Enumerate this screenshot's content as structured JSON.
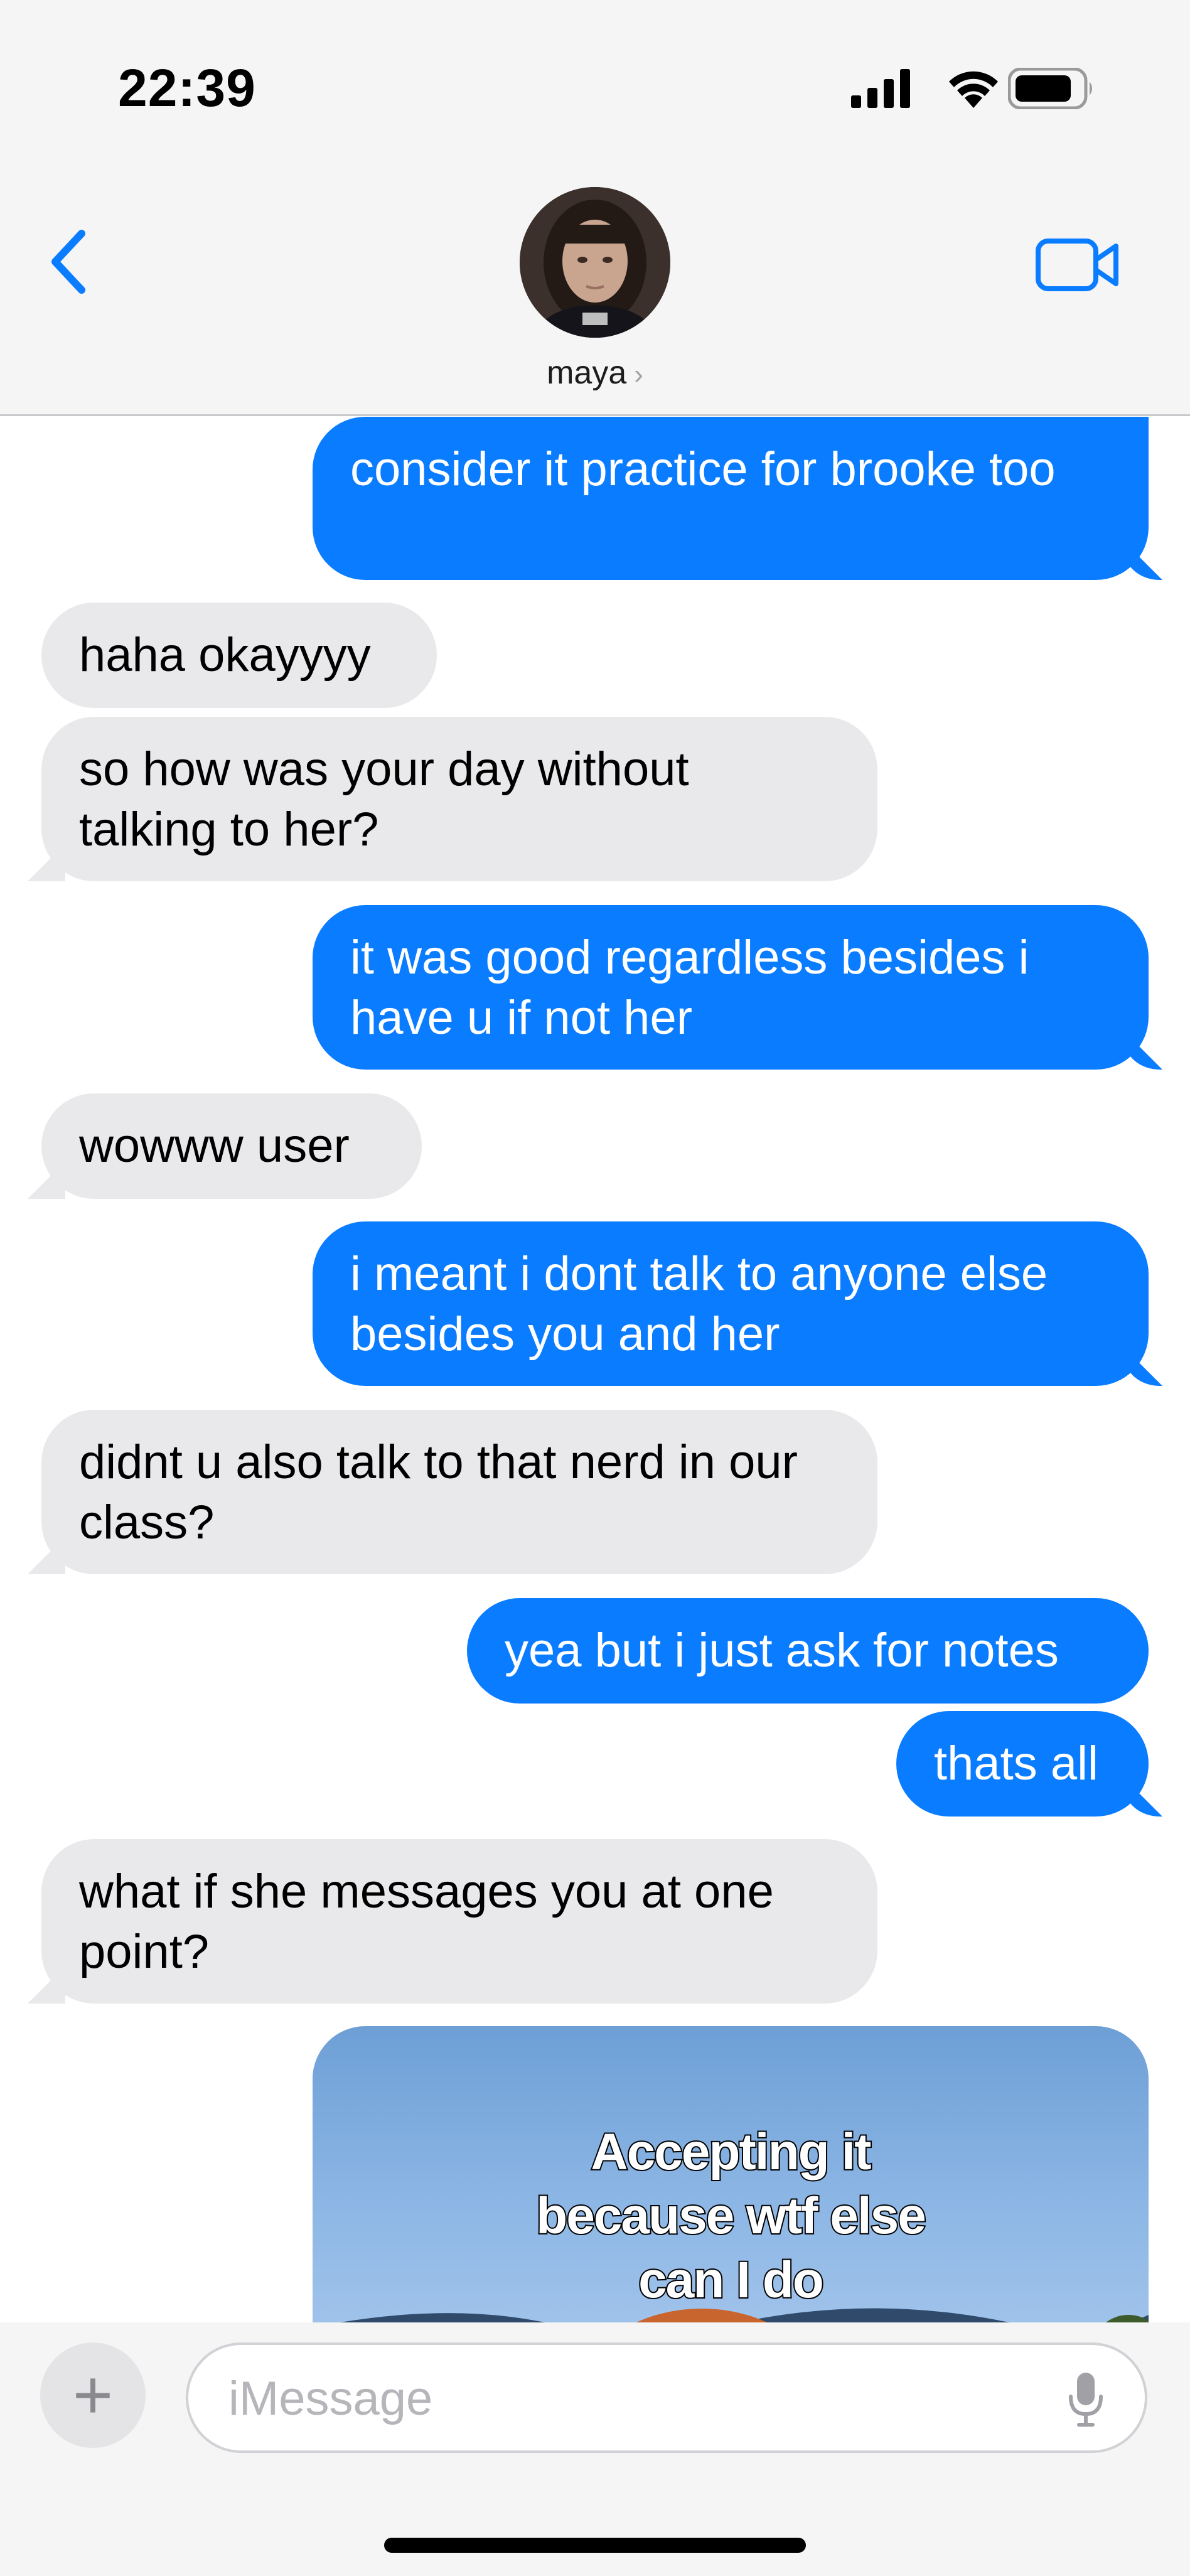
{
  "status_bar": {
    "time": "22:39"
  },
  "header": {
    "contact_name": "maya",
    "chevron": "›",
    "back_icon": "chevron-left-icon",
    "video_icon": "video-camera-icon"
  },
  "messages": [
    {
      "from": "me",
      "text": "consider it practice for brooke too"
    },
    {
      "from": "them",
      "text": "haha okayyyy"
    },
    {
      "from": "them",
      "text": "so how was your day without talking to her?"
    },
    {
      "from": "me",
      "text": "it was good regardless besides i have u if not her"
    },
    {
      "from": "them",
      "text": "wowww user"
    },
    {
      "from": "me",
      "text": "i meant i dont talk to anyone else besides you and her"
    },
    {
      "from": "them",
      "text": "didnt u also talk to that nerd in our class?"
    },
    {
      "from": "me",
      "text": "yea but i just ask for notes"
    },
    {
      "from": "me",
      "text": "thats all"
    },
    {
      "from": "them",
      "text": "what if she messages you at one point?"
    },
    {
      "from": "me",
      "type": "image",
      "caption": "Accepting it because wtf else can I do"
    }
  ],
  "input": {
    "placeholder": "iMessage",
    "plus_label": "+",
    "mic_icon": "microphone-icon"
  },
  "colors": {
    "sent_bubble": "#0a7cff",
    "received_bubble": "#e9e9eb",
    "accent": "#0a7cff"
  }
}
